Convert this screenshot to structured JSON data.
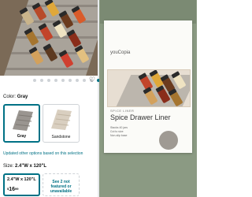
{
  "gallery": {
    "dot_count": 10,
    "active_index": 9
  },
  "selection": {
    "color_label": "Color:",
    "color_value": "Gray",
    "size_label": "Size:",
    "size_value": "2.4\"W x 120\"L"
  },
  "swatches": [
    {
      "label": "Gray",
      "selected": true,
      "color": "#9a9590"
    },
    {
      "label": "Sandstone",
      "selected": false,
      "color": "#d9cfc0"
    }
  ],
  "updated_text": "Updated other options based on this selection",
  "sizes": [
    {
      "label": "2.4\"W x 120\"L",
      "price_whole": "16",
      "price_cents": "99",
      "currency": "$"
    },
    {
      "unavailable_text": "See 2 not featured or unavailable"
    }
  ],
  "package": {
    "brand": "youCopia",
    "sub_brand": "SPICE LINER",
    "title": "Spice Drawer Liner",
    "bullets": [
      "Stacks 40 jars",
      "Cut to size",
      "Non-slip base"
    ]
  },
  "colors": {
    "accent": "#007185",
    "text": "#0f1111",
    "panel_bg": "#8b9a83"
  }
}
